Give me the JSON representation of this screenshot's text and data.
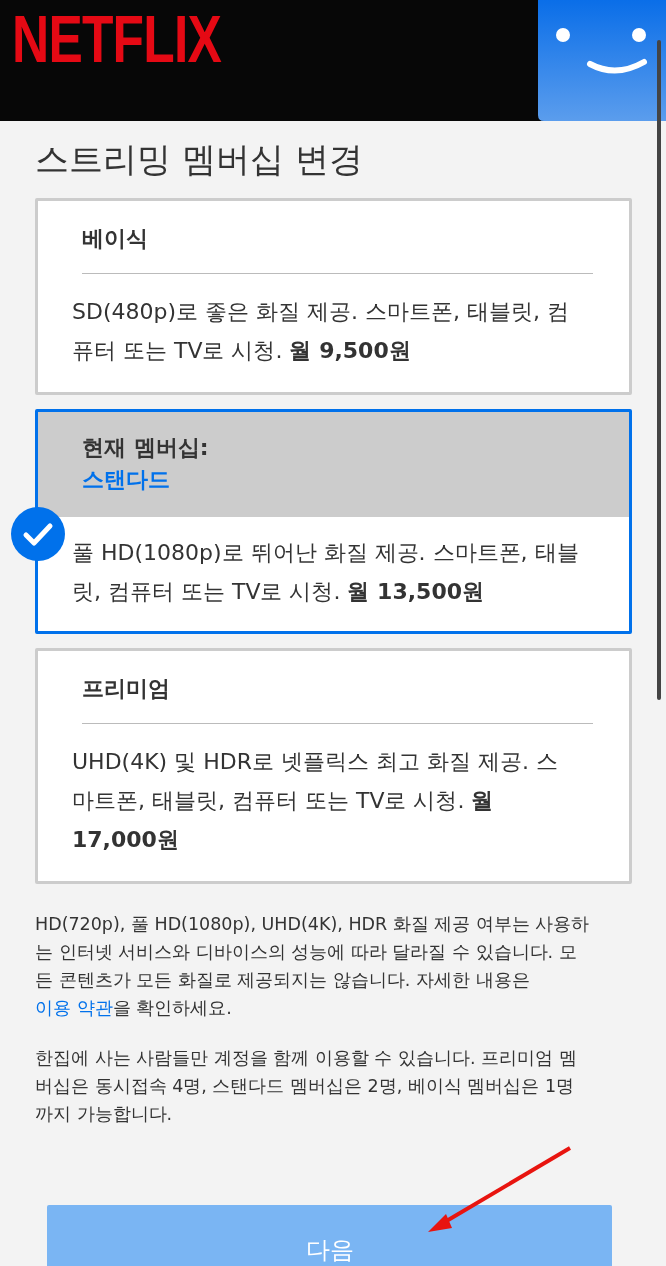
{
  "header": {
    "logo": "NETFLIX"
  },
  "title": "스트리밍 멤버십 변경",
  "current_label": "현재 멤버십:",
  "plans": [
    {
      "name": "베이식",
      "description": "SD(480p)로 좋은 화질 제공. 스마트폰, 태블릿, 컴퓨터 또는 TV로 시청. **월 9,500원**",
      "selected": false
    },
    {
      "name": "스탠다드",
      "description": "풀 HD(1080p)로 뛰어난 화질 제공. 스마트폰, 태블릿, 컴퓨터 또는 TV로 시청. **월 13,500원**",
      "selected": true
    },
    {
      "name": "프리미엄",
      "description": "UHD(4K) 및 HDR로 넷플릭스 최고 화질 제공. 스마트폰, 태블릿, 컴퓨터 또는 TV로 시청. **월 17,000원**",
      "selected": false
    }
  ],
  "notes": [
    {
      "text": "HD(720p), 풀 HD(1080p), UHD(4K), HDR 화질 제공 여부는 사용하는 인터넷 서비스와 디바이스의 성능에 따라 달라질 수 있습니다. 모든 콘텐츠가 모든 화질로 제공되지는 않습니다. 자세한 내용은 ",
      "link": "이용 약관",
      "after": "을 확인하세요."
    },
    {
      "text": "한집에 사는 사람들만 계정을 함께 이용할 수 있습니다. 프리미엄 멤버십은 동시접속 4명, 스탠다드 멤버십은 2명, 베이식 멤버십은 1명까지 가능합니다."
    }
  ],
  "next_button": {
    "label": "다음"
  }
}
